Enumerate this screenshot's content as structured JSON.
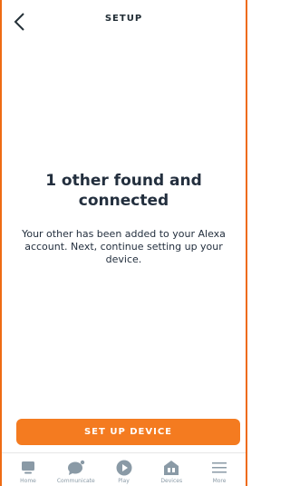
{
  "header": {
    "title": "SETUP",
    "back_icon": "chevron-left-icon"
  },
  "main": {
    "title": "1 other found and connected",
    "body": "Your other has been added to your Alexa account. Next, continue setting up your device."
  },
  "cta": {
    "label": "SET UP DEVICE"
  },
  "nav": {
    "items": [
      {
        "label": "Home",
        "icon": "home-icon"
      },
      {
        "label": "Communicate",
        "icon": "chat-bubble-icon"
      },
      {
        "label": "Play",
        "icon": "play-icon"
      },
      {
        "label": "Devices",
        "icon": "devices-icon"
      },
      {
        "label": "More",
        "icon": "menu-icon"
      }
    ]
  },
  "colors": {
    "accent": "#f47b20",
    "nav_icon": "#8a9aa6",
    "text": "#232f3e"
  }
}
